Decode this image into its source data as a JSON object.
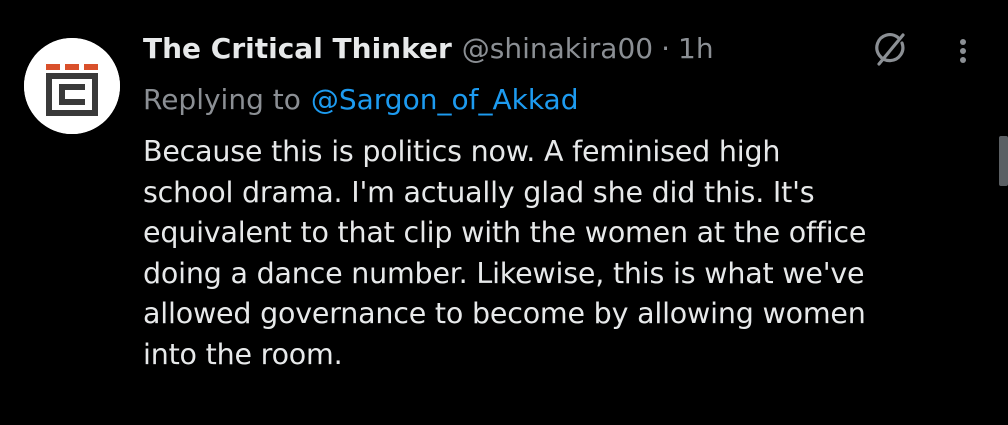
{
  "tweet": {
    "author": {
      "display_name": "The Critical Thinker",
      "handle": "@shinakira00",
      "avatar_icon": "critical-thinker-logo-icon"
    },
    "separator": "·",
    "time": "1h",
    "reply": {
      "prefix": "Replying to",
      "mention": "@Sargon_of_Akkad"
    },
    "lines": [
      "Because this is politics now. A feminised high",
      "school drama. I'm actually glad she did this. It's",
      "equivalent to that clip with the women at the office",
      "doing a dance number. Likewise, this is what we've",
      "allowed governance to become by allowing women",
      "into the room."
    ],
    "icons": {
      "grok": "grok-icon",
      "more": "more-icon"
    }
  },
  "colors": {
    "background": "#000000",
    "text_primary": "#e7e9ea",
    "text_secondary": "#8b8f94",
    "accent": "#1d9bf0",
    "logo_red": "#d9502b",
    "logo_dark": "#3a3a3a"
  }
}
